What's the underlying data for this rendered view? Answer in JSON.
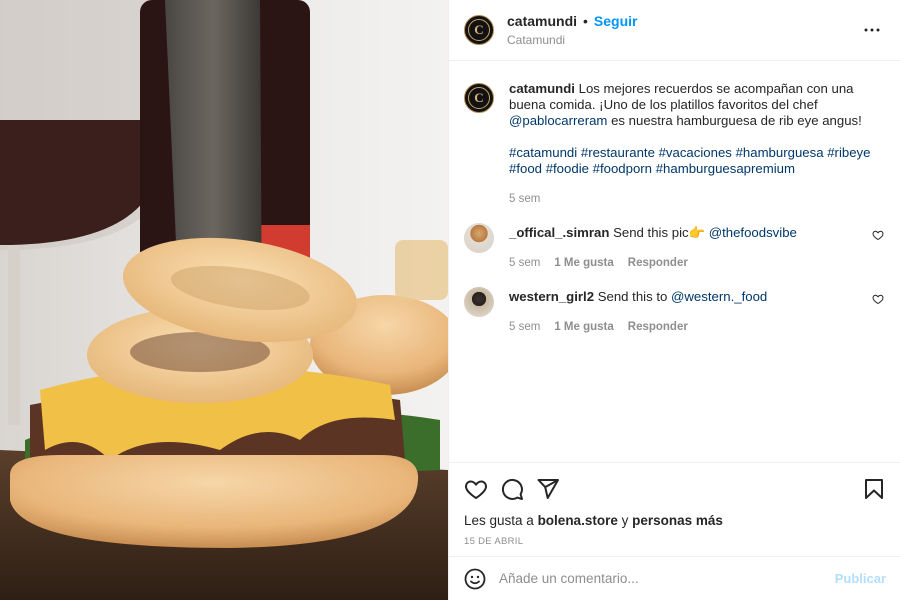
{
  "header": {
    "username": "catamundi",
    "separator": "•",
    "follow_label": "Seguir",
    "subtitle": "Catamundi",
    "more_icon": "more-horizontal-icon",
    "avatar_letter": "C"
  },
  "caption": {
    "username": "catamundi",
    "text_1": " Los mejores recuerdos se acompañan con una buena comida. ¡Uno de los platillos favoritos del chef ",
    "mention": "@pablocarreram",
    "text_2": " es nuestra hamburguesa de rib eye angus!",
    "hashtags": [
      "#catamundi",
      "#restaurante",
      "#vacaciones",
      "#hamburguesa",
      "#ribeye",
      "#food",
      "#foodie",
      "#foodporn",
      "#hamburguesapremium"
    ],
    "time": "5 sem"
  },
  "comments": [
    {
      "username": "_offical_.simran",
      "text": " Send this pic👉 ",
      "mention": "@thefoodsvibe",
      "time": "5 sem",
      "likes": "1 Me gusta",
      "reply": "Responder"
    },
    {
      "username": "western_girl2",
      "text": " Send this to ",
      "mention": "@western._food",
      "time": "5 sem",
      "likes": "1 Me gusta",
      "reply": "Responder"
    }
  ],
  "actions": {
    "icons": [
      "heart-icon",
      "comment-icon",
      "share-icon",
      "bookmark-icon"
    ],
    "likes_prefix": "Les gusta a ",
    "likes_user": "bolena.store",
    "likes_mid": " y ",
    "likes_others": "personas más",
    "date": "15 DE ABRIL"
  },
  "composer": {
    "placeholder": "Añade un comentario...",
    "post_label": "Publicar"
  },
  "colors": {
    "accent": "#0095f6",
    "link": "#00376b",
    "muted": "#8e8e8e",
    "post_disabled": "#b2dffc"
  }
}
